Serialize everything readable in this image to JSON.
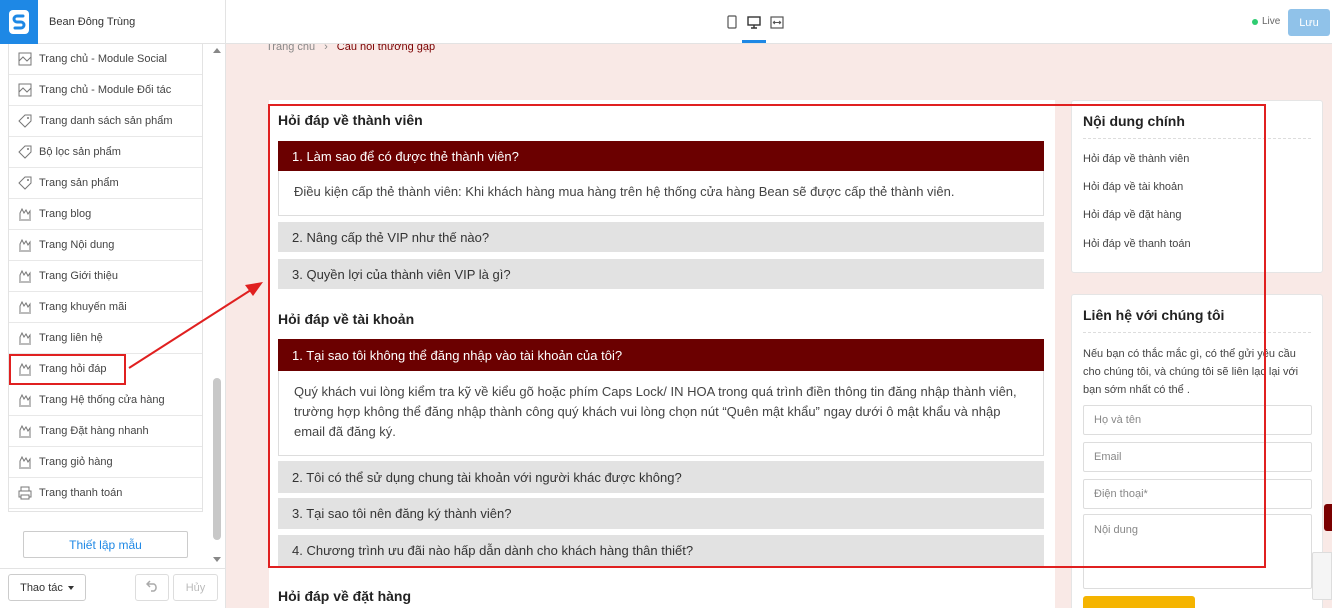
{
  "app": {
    "store_name": "Bean Đông Trùng"
  },
  "sidebar": {
    "items": [
      {
        "label": "Trang chủ - Module Social",
        "icon": "layout-icon"
      },
      {
        "label": "Trang chủ - Module Đối tác",
        "icon": "layout-icon"
      },
      {
        "label": "Trang danh sách sản phẩm",
        "icon": "tag-icon"
      },
      {
        "label": "Bộ lọc sản phẩm",
        "icon": "tag-icon"
      },
      {
        "label": "Trang sản phẩm",
        "icon": "tag-icon"
      },
      {
        "label": "Trang blog",
        "icon": "page-icon"
      },
      {
        "label": "Trang Nội dung",
        "icon": "page-icon"
      },
      {
        "label": "Trang Giới thiệu",
        "icon": "page-icon"
      },
      {
        "label": "Trang khuyến mãi",
        "icon": "page-icon"
      },
      {
        "label": "Trang liên hệ",
        "icon": "page-icon"
      },
      {
        "label": "Trang hỏi đáp",
        "icon": "page-icon",
        "highlighted": true
      },
      {
        "label": "Trang Hệ thống cửa hàng",
        "icon": "page-icon"
      },
      {
        "label": "Trang Đặt hàng nhanh",
        "icon": "page-icon"
      },
      {
        "label": "Trang giỏ hàng",
        "icon": "page-icon"
      },
      {
        "label": "Trang thanh toán",
        "icon": "printer-icon"
      }
    ],
    "setup_button": "Thiết lập mẫu",
    "actions_button": "Thao tác",
    "cancel_button": "Hủy"
  },
  "topbar": {
    "devices": [
      "mobile-icon",
      "desktop-icon",
      "fullwidth-icon"
    ],
    "active_device": "desktop-icon",
    "live_label": "Live",
    "save_button": "Lưu"
  },
  "preview": {
    "breadcrumb": {
      "home": "Trang chủ",
      "current": "Câu hỏi thường gặp"
    },
    "sections": [
      {
        "title": "Hỏi đáp về thành viên",
        "questions": [
          {
            "q": "1. Làm sao để có được thẻ thành viên?",
            "open": true,
            "a": "Điều kiện cấp thẻ thành viên: Khi khách hàng mua hàng trên hệ thống cửa hàng Bean sẽ được cấp thẻ thành viên."
          },
          {
            "q": "2. Nâng cấp thẻ VIP như thế nào?",
            "open": false
          },
          {
            "q": "3. Quyền lợi của thành viên VIP là gì?",
            "open": false
          }
        ]
      },
      {
        "title": "Hỏi đáp về tài khoản",
        "questions": [
          {
            "q": "1. Tại sao tôi không thể đăng nhập vào tài khoản của tôi?",
            "open": true,
            "a": "Quý khách vui lòng kiểm tra kỹ về kiểu gõ hoặc phím Caps Lock/ IN HOA trong quá trình điền thông tin đăng nhập thành viên, trường hợp không thể đăng nhập thành công quý khách vui lòng chọn nút “Quên mật khẩu” ngay dưới ô mật khẩu và nhập email đã đăng ký."
          },
          {
            "q": "2. Tôi có thể sử dụng chung tài khoản với người khác được không?",
            "open": false
          },
          {
            "q": "3. Tại sao tôi nên đăng ký thành viên?",
            "open": false
          },
          {
            "q": "4. Chương trình ưu đãi nào hấp dẫn dành cho khách hàng thân thiết?",
            "open": false
          }
        ]
      },
      {
        "title": "Hỏi đáp về đặt hàng",
        "questions": []
      }
    ],
    "toc": {
      "title": "Nội dung chính",
      "links": [
        "Hỏi đáp về thành viên",
        "Hỏi đáp về tài khoản",
        "Hỏi đáp về đặt hàng",
        "Hỏi đáp về thanh toán"
      ]
    },
    "contact": {
      "title": "Liên hệ với chúng tôi",
      "desc": "Nếu bạn có thắc mắc gì, có thể gửi yêu cầu cho chúng tôi, và chúng tôi sẽ liên lạc lại với bạn sớm nhất có thể .",
      "name_placeholder": "Họ và tên",
      "email_placeholder": "Email",
      "phone_placeholder": "Điện thoại*",
      "content_placeholder": "Nội dung"
    }
  },
  "colors": {
    "accent": "#1e88e5",
    "faq_open": "#6b0000",
    "annotation": "#e02020",
    "submit": "#f5b400"
  }
}
